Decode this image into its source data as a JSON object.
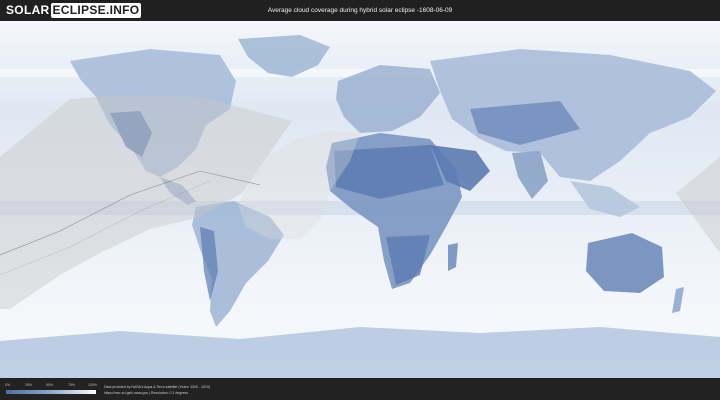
{
  "header": {
    "logo_part1": "SOLAR",
    "logo_part2": "ECLIPSE.INFO",
    "title": "Average cloud coverage during hybrid solar eclipse -1608-06-09"
  },
  "legend": {
    "ticks": [
      "0%",
      "25%",
      "50%",
      "75%",
      "100%"
    ],
    "colors": [
      "#4a6fa5",
      "#8ca8cc",
      "#ffffff"
    ]
  },
  "footer": {
    "credit_line1": "Data provided by NASA's Aqua & Terra satellite (Years: 2000 - 2019)",
    "credit_line2": "https://neo.sci.gsfc.nasa.gov | Resolution: 0.1 degrees"
  },
  "colors": {
    "ocean_cloud": "#eef3f8",
    "land_clear": "#5b7bb0",
    "shadow_overlay": "#c8c8c8"
  }
}
